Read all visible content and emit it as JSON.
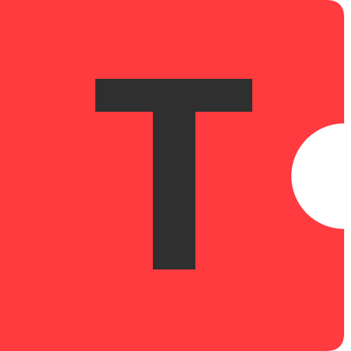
{
  "logo": {
    "letter": "T",
    "name": "ticket-logo-icon"
  },
  "colors": {
    "background": "#ffffff",
    "ticket": "#ff3b3f",
    "letter": "#2f2f2f",
    "notch": "#ffffff"
  }
}
